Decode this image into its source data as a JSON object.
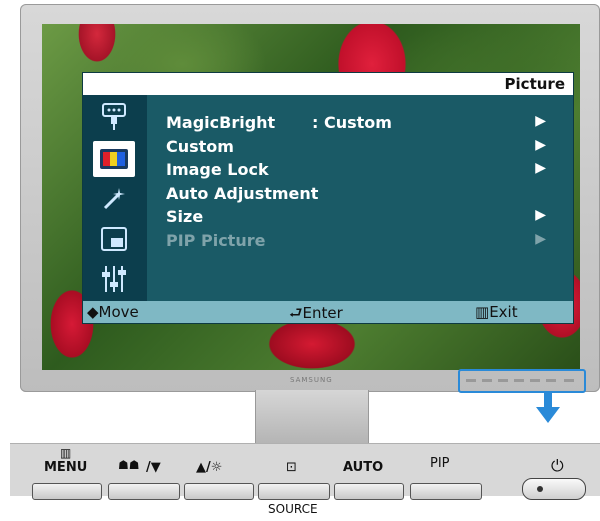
{
  "osd": {
    "title": "Picture",
    "menu": [
      {
        "label": "MagicBright",
        "value": ": Custom",
        "arrow": "▶"
      },
      {
        "label": "Custom",
        "value": "",
        "arrow": "▶"
      },
      {
        "label": "Image Lock",
        "value": "",
        "arrow": "▶"
      },
      {
        "label": "Auto Adjustment",
        "value": "",
        "arrow": ""
      },
      {
        "label": "Size",
        "value": "",
        "arrow": "▶"
      },
      {
        "label": "PIP Picture",
        "value": "",
        "arrow": "▶"
      }
    ],
    "footer": {
      "move": "Move",
      "enter": "Enter",
      "exit": "Exit"
    }
  },
  "bezel": {
    "brand": "SAMSUNG"
  },
  "panel": {
    "menu_label": "MENU",
    "brightness_label": "▲/☼",
    "magicbright_label": "/▼",
    "auto_label": "AUTO",
    "pip_label": "PIP",
    "source_label": "SOURCE"
  },
  "colors": {
    "osd_bg": "#1a5a66",
    "osd_side": "#0c3e4d",
    "footer": "#7fb8c4",
    "highlight": "#2a8ad8"
  }
}
